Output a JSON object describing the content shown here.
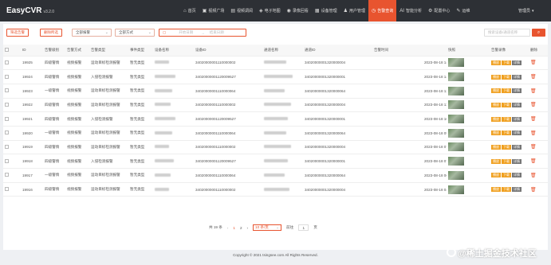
{
  "app": {
    "name": "EasyCVR",
    "version": "v3.2.0"
  },
  "nav": [
    {
      "icon": "home-icon",
      "glyph": "⌂",
      "label": "首页"
    },
    {
      "icon": "video-square-icon",
      "glyph": "▣",
      "label": "视频广场"
    },
    {
      "icon": "video-icon",
      "glyph": "▤",
      "label": "视频调阅"
    },
    {
      "icon": "map-icon",
      "glyph": "◈",
      "label": "电子地图"
    },
    {
      "icon": "record-icon",
      "glyph": "◉",
      "label": "录像回看"
    },
    {
      "icon": "device-icon",
      "glyph": "▦",
      "label": "设备管理"
    },
    {
      "icon": "user-icon",
      "glyph": "♟",
      "label": "用户管理"
    },
    {
      "icon": "alarm-icon",
      "glyph": "◷",
      "label": "告警查询"
    },
    {
      "icon": "ai-icon",
      "glyph": "AI",
      "label": "智能分析"
    },
    {
      "icon": "settings-icon",
      "glyph": "⚙",
      "label": "配置中心"
    },
    {
      "icon": "ops-icon",
      "glyph": "✎",
      "label": "运维"
    }
  ],
  "user": {
    "label": "管理员",
    "caret": "▾"
  },
  "toolbar": {
    "btn_left": "筛选告警",
    "btn_right": "删除所选",
    "type_select": "全部报警",
    "method_select": "全部方式",
    "date_start": "开始日期",
    "date_sep": "→",
    "date_end": "结束日期",
    "search_placeholder": "搜索设备/通道名称",
    "search_icon": "search-icon"
  },
  "table": {
    "headers": [
      "ID",
      "告警级别",
      "告警方式",
      "告警类型",
      "事件类型",
      "设备名称",
      "设备ID",
      "通道名称",
      "通道ID",
      "告警时间",
      "快照",
      "告警录像",
      "删除"
    ],
    "rows": [
      {
        "id": "19925",
        "level": "四级警情",
        "method": "视频报警",
        "type": "运动目标检测报警",
        "event": "暂无类型",
        "device": "",
        "device_id": "34020000001110000002",
        "channel": "",
        "channel_id": "34020000001320000004",
        "time": "2023-08-18 14:29:35"
      },
      {
        "id": "19924",
        "level": "四级警情",
        "method": "视频报警",
        "type": "入侵检测报警",
        "event": "暂无类型",
        "device": "",
        "device_id": "34020000001120009527",
        "channel": "",
        "channel_id": "34020000001320000001",
        "time": "2023-08-18 14:29:31"
      },
      {
        "id": "19923",
        "level": "一级警情",
        "method": "视频报警",
        "type": "运动目标检测报警",
        "event": "暂无类型",
        "device": "",
        "device_id": "34020000001110000064",
        "channel": "",
        "channel_id": "34020000001320000064",
        "time": "2023-08-18 13:02:55"
      },
      {
        "id": "19922",
        "level": "四级警情",
        "method": "视频报警",
        "type": "运动目标检测报警",
        "event": "暂无类型",
        "device": "",
        "device_id": "34020000001110000002",
        "channel": "",
        "channel_id": "34020000001320000004",
        "time": "2023-08-18 11:09:29"
      },
      {
        "id": "19921",
        "level": "四级警情",
        "method": "视频报警",
        "type": "入侵检测报警",
        "event": "暂无类型",
        "device": "",
        "device_id": "34020000001120009527",
        "channel": "",
        "channel_id": "34020000001320000001",
        "time": "2023-08-18 10:56:36"
      },
      {
        "id": "19920",
        "level": "一级警情",
        "method": "视频报警",
        "type": "运动目标检测报警",
        "event": "暂无类型",
        "device": "",
        "device_id": "34020000001110000064",
        "channel": "",
        "channel_id": "34020000001320000064",
        "time": "2023-08-18 09:41:54"
      },
      {
        "id": "19919",
        "level": "四级警情",
        "method": "视频报警",
        "type": "运动目标检测报警",
        "event": "暂无类型",
        "device": "",
        "device_id": "34020000001110000002",
        "channel": "",
        "channel_id": "34020000001320000004",
        "time": "2023-08-18 07:38:39"
      },
      {
        "id": "19918",
        "level": "四级警情",
        "method": "视频报警",
        "type": "入侵检测报警",
        "event": "暂无类型",
        "device": "",
        "device_id": "34020000001120009527",
        "channel": "",
        "channel_id": "34020000001320000001",
        "time": "2023-08-18 07:38:39"
      },
      {
        "id": "19917",
        "level": "一级警情",
        "method": "视频报警",
        "type": "运动目标检测报警",
        "event": "暂无类型",
        "device": "",
        "device_id": "34020000001110000064",
        "channel": "",
        "channel_id": "34020000001320000064",
        "time": "2023-08-18 06:20:47"
      },
      {
        "id": "19916",
        "level": "四级警情",
        "method": "视频报警",
        "type": "运动目标检测报警",
        "event": "暂无类型",
        "device": "",
        "device_id": "34020000001110000002",
        "channel": "",
        "channel_id": "34020000001320000004",
        "time": "2023-08-18 04:16:43"
      }
    ],
    "ops": {
      "play": "播放",
      "download": "下载",
      "detail": "详情"
    },
    "delete_icon": "trash-icon"
  },
  "pager": {
    "total": "共 19 条",
    "prev": "‹",
    "pages": [
      "1",
      "2"
    ],
    "current": "1",
    "next": "›",
    "size": "10 条/页",
    "goto_label": "前往",
    "goto_value": "1",
    "goto_suffix": "页"
  },
  "footer": "Copyright © 2021 tsingsee.com All Rights Reserved.",
  "watermark": "@稀土掘金技术社区",
  "colors": {
    "accent": "#e8542f",
    "topbar": "#2d3035"
  }
}
